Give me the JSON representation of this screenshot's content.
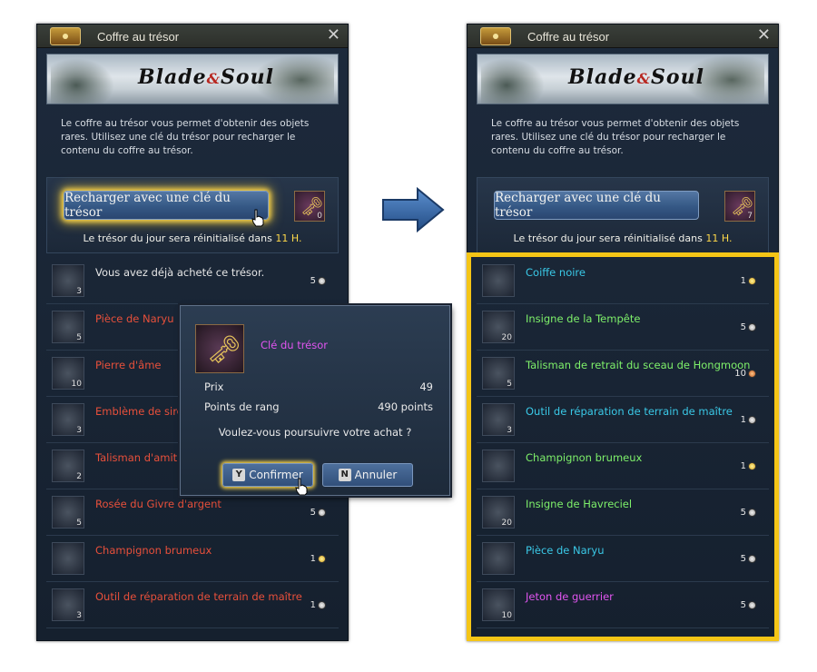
{
  "colors": {
    "accent_gold": "#ffd94a",
    "highlight_border": "#f5c516"
  },
  "left_panel": {
    "title": "Coffre au trésor",
    "banner_logo": "Blade",
    "banner_logo_amp": "&",
    "banner_logo_tail": "Soul",
    "description": "Le coffre au trésor vous permet d'obtenir des objets rares. Utilisez une clé du trésor pour recharger le contenu du coffre au trésor.",
    "reload_button": "Recharger avec une clé du trésor",
    "key_quantity": "0",
    "reset_prefix": "Le trésor du jour sera réinitialisé dans",
    "reset_hours": "11",
    "reset_suffix": "H.",
    "items": [
      {
        "name": "Vous avez déjà acheté ce trésor.",
        "qty": "3",
        "price": "5",
        "coin": "silver",
        "color": "white"
      },
      {
        "name": "Pièce de Naryu",
        "qty": "5",
        "price": "",
        "coin": "",
        "color": "red"
      },
      {
        "name": "Pierre d'âme",
        "qty": "10",
        "price": "",
        "coin": "",
        "color": "red"
      },
      {
        "name": "Emblème de sirè",
        "qty": "3",
        "price": "",
        "coin": "",
        "color": "red"
      },
      {
        "name": "Talisman d'amitié",
        "qty": "2",
        "price": "",
        "coin": "",
        "color": "red"
      },
      {
        "name": "Rosée du Givre d'argent",
        "qty": "5",
        "price": "5",
        "coin": "silver",
        "color": "red"
      },
      {
        "name": "Champignon brumeux",
        "qty": "",
        "price": "1",
        "coin": "gold",
        "color": "red"
      },
      {
        "name": "Outil de réparation de terrain de maître",
        "qty": "3",
        "price": "1",
        "coin": "silver",
        "color": "red"
      }
    ]
  },
  "dialog": {
    "item_name": "Clé du trésor",
    "price_label": "Prix",
    "price_value": "49",
    "rank_label": "Points de rang",
    "rank_value": "490 points",
    "question": "Voulez-vous poursuivre votre achat ?",
    "confirm_hotkey": "Y",
    "confirm_label": "Confirmer",
    "cancel_hotkey": "N",
    "cancel_label": "Annuler"
  },
  "right_panel": {
    "title": "Coffre au trésor",
    "banner_logo": "Blade",
    "banner_logo_amp": "&",
    "banner_logo_tail": "Soul",
    "description": "Le coffre au trésor vous permet d'obtenir des objets rares. Utilisez une clé du trésor pour recharger le contenu du coffre au trésor.",
    "reload_button": "Recharger avec une clé du trésor",
    "key_quantity": "7",
    "reset_prefix": "Le trésor du jour sera réinitialisé dans",
    "reset_hours": "11",
    "reset_suffix": "H.",
    "items": [
      {
        "name": "Coiffe noire",
        "qty": "",
        "price": "1",
        "coin": "gold",
        "color": "cyan"
      },
      {
        "name": "Insigne de la Tempête",
        "qty": "20",
        "price": "5",
        "coin": "silver",
        "color": "green"
      },
      {
        "name": "Talisman de retrait du sceau de Hongmoon",
        "qty": "5",
        "price": "10",
        "coin": "copper",
        "color": "green"
      },
      {
        "name": "Outil de réparation de terrain de maître",
        "qty": "3",
        "price": "1",
        "coin": "silver",
        "color": "cyan"
      },
      {
        "name": "Champignon brumeux",
        "qty": "",
        "price": "1",
        "coin": "gold",
        "color": "green"
      },
      {
        "name": "Insigne de Havreciel",
        "qty": "20",
        "price": "5",
        "coin": "silver",
        "color": "green"
      },
      {
        "name": "Pièce de Naryu",
        "qty": "",
        "price": "5",
        "coin": "silver",
        "color": "cyan"
      },
      {
        "name": "Jeton de guerrier",
        "qty": "10",
        "price": "5",
        "coin": "silver",
        "color": "purple"
      }
    ]
  }
}
